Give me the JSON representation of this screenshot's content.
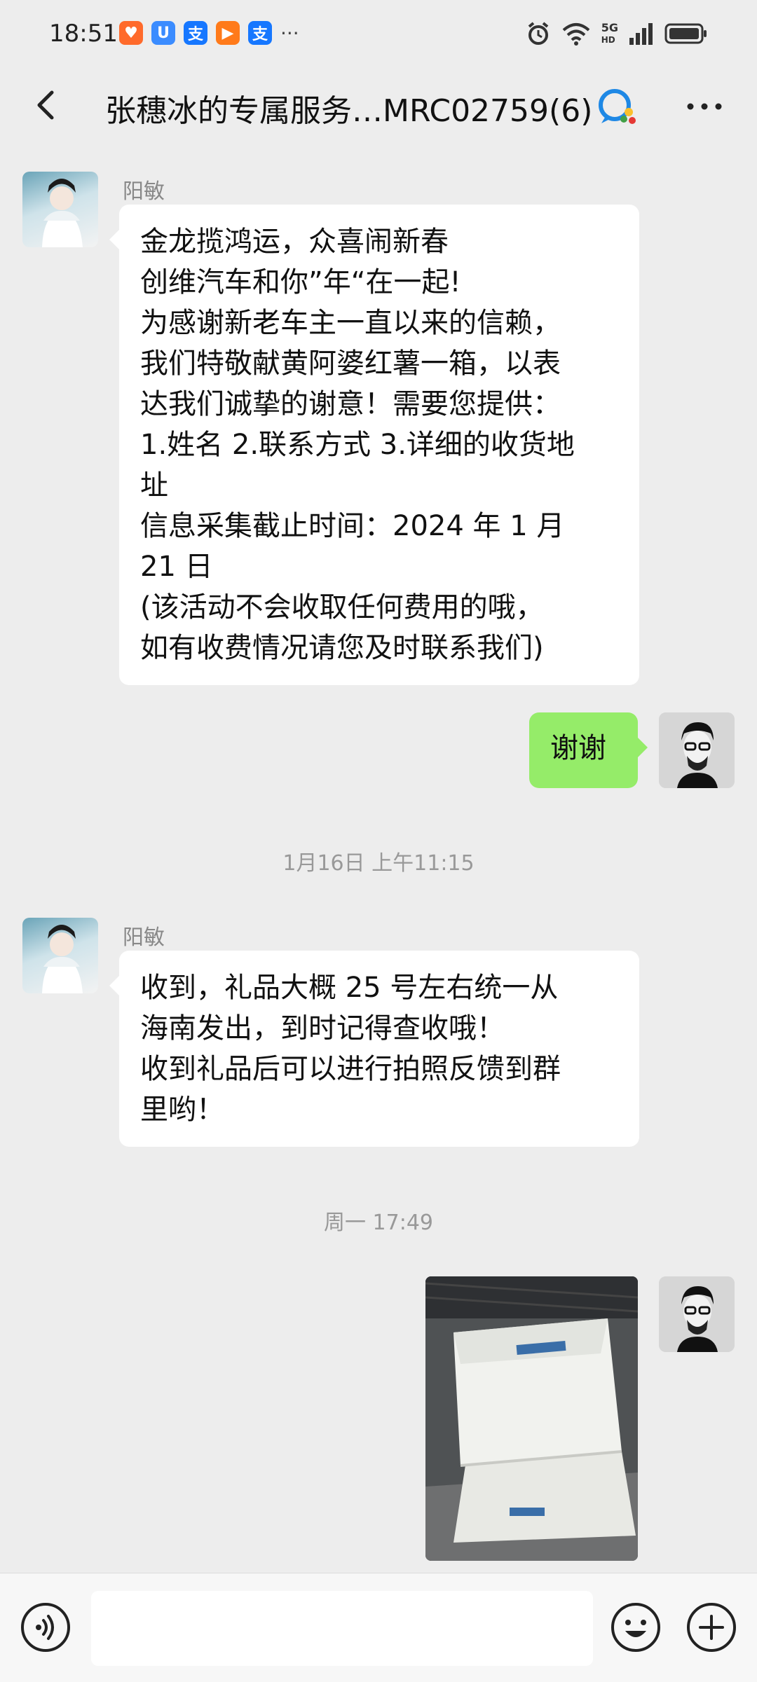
{
  "status_bar": {
    "time": "18:51",
    "app_icons": [
      {
        "name": "taobao-icon",
        "glyph": "♥",
        "color": "#ff6a2b"
      },
      {
        "name": "ubox-icon",
        "glyph": "U",
        "color": "#3b8cff"
      },
      {
        "name": "alipay-icon",
        "glyph": "支",
        "color": "#1677ff"
      },
      {
        "name": "video-icon",
        "glyph": "▶",
        "color": "#ff7a1a"
      },
      {
        "name": "alipay-icon-2",
        "glyph": "支",
        "color": "#1677ff"
      }
    ],
    "more_glyph": "···",
    "network": "5G",
    "signal": "HD"
  },
  "header": {
    "title": "张穗冰的专属服务…MRC02759(6)"
  },
  "messages": {
    "m1": {
      "sender": "阳敏",
      "lines": [
        "金龙揽鸿运，众喜闹新春",
        "创维汽车和你”年“在一起!",
        "为感谢新老车主一直以来的信赖，",
        "我们特敬献黄阿婆红薯一箱，以表",
        "达我们诚挚的谢意！需要您提供：",
        "1.姓名 2.联系方式 3.详细的收货地",
        "址",
        "信息采集截止时间：2024 年 1 月",
        "21 日",
        "(该活动不会收取任何费用的哦，",
        "如有收费情况请您及时联系我们)"
      ]
    },
    "m2": {
      "text": "谢谢"
    },
    "ts1": "1月16日 上午11:15",
    "m3": {
      "sender": "阳敏",
      "lines": [
        "收到，礼品大概 25 号左右统一从",
        "海南发出，到时记得查收哦！",
        "收到礼品后可以进行拍照反馈到群",
        "里哟！"
      ]
    },
    "ts2": "周一 17:49"
  },
  "colors": {
    "background": "#ededed",
    "self_bubble": "#95ec69",
    "other_bubble": "#ffffff",
    "input_bar": "#f7f7f7"
  }
}
